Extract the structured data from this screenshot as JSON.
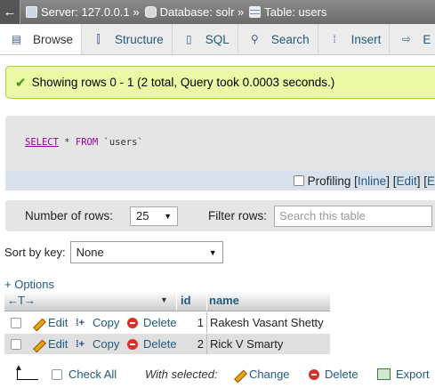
{
  "breadcrumb": {
    "back": "←",
    "server": "Server: 127.0.0.1 »",
    "database": "Database: solr »",
    "table": "Table: users"
  },
  "tabs": [
    {
      "label": "Browse",
      "icon": "browse-icon"
    },
    {
      "label": "Structure",
      "icon": "structure-icon"
    },
    {
      "label": "SQL",
      "icon": "sql-icon"
    },
    {
      "label": "Search",
      "icon": "search-icon"
    },
    {
      "label": "Insert",
      "icon": "insert-icon"
    },
    {
      "label": "E",
      "icon": "export-icon"
    }
  ],
  "message": "Showing rows 0 - 1 (2 total, Query took 0.0003 seconds.)",
  "sql": {
    "select": "SELECT",
    "star": " * ",
    "from": "FROM",
    "table": " `users`"
  },
  "profiling": {
    "label": "Profiling",
    "open": "[ ",
    "inline": "Inline",
    "mid": " ] [ ",
    "edit": "Edit",
    "close": " ] [ ",
    "more": "E"
  },
  "nav": {
    "rows_label": "Number of rows:",
    "rows_value": "25",
    "filter_label": "Filter rows:",
    "filter_placeholder": "Search this table"
  },
  "sort": {
    "label": "Sort by key:",
    "value": "None"
  },
  "options_link": "+ Options",
  "table": {
    "arrows": "←T→",
    "columns": [
      "id",
      "name"
    ],
    "rows": [
      {
        "edit": "Edit",
        "copy": "Copy",
        "delete": "Delete",
        "id": "1",
        "name": "Rakesh Vasant Shetty"
      },
      {
        "edit": "Edit",
        "copy": "Copy",
        "delete": "Delete",
        "id": "2",
        "name": "Rick V Smarty"
      }
    ]
  },
  "bottom": {
    "check_all": "Check All",
    "with_selected": "With selected:",
    "change": "Change",
    "delete": "Delete",
    "export": "Export"
  },
  "colors": {
    "link": "#235a81",
    "success_bg": "#ebf8a4",
    "topbar": "#7a7a7a"
  }
}
